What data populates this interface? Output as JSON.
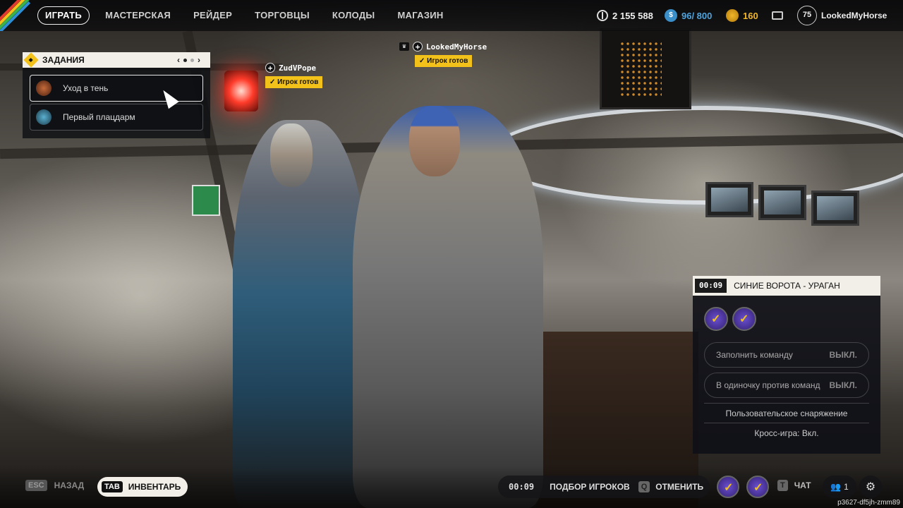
{
  "nav": {
    "items": [
      "ИГРАТЬ",
      "МАСТЕРСКАЯ",
      "РЕЙДЕР",
      "ТОРГОВЦЫ",
      "КОЛОДЫ",
      "МАГАЗИН"
    ],
    "active": "ИГРАТЬ"
  },
  "resources": {
    "credits": "2 155 588",
    "blue": "96/ 800",
    "gold": "160",
    "level": "75",
    "username": "LookedMyHorse"
  },
  "quests": {
    "title": "ЗАДАНИЯ",
    "items": [
      {
        "label": "Уход в тень",
        "selected": true
      },
      {
        "label": "Первый плацдарм",
        "selected": false
      }
    ]
  },
  "players": [
    {
      "name": "ZudVPope",
      "status": "Игрок готов"
    },
    {
      "name": "LookedMyHorse",
      "status": "Игрок готов"
    }
  ],
  "mode": {
    "timer": "00:09",
    "title": "СИНИЕ ВОРОТА - УРАГАН",
    "options": [
      {
        "label": "Заполнить команду",
        "value": "ВЫКЛ."
      },
      {
        "label": "В одиночку против команд",
        "value": "ВЫКЛ."
      }
    ],
    "custom_gear": "Пользовательское снаряжение",
    "crossplay": "Кросс-игра: Вкл."
  },
  "bottom": {
    "back_key": "ESC",
    "back_label": "НАЗАД",
    "inv_key": "TAB",
    "inv_label": "ИНВЕНТАРЬ",
    "search_timer": "00:09",
    "search_label": "ПОДБОР ИГРОКОВ",
    "cancel_key": "Q",
    "cancel_label": "ОТМЕНИТЬ",
    "chat_key": "T",
    "chat_label": "ЧАТ",
    "party_count": "1",
    "build_id": "p3627-df5jh-zmm89"
  },
  "colors": {
    "accent_yellow": "#f2c21b",
    "panel_light": "#f2efe8",
    "panel_dark": "#0e1016"
  }
}
